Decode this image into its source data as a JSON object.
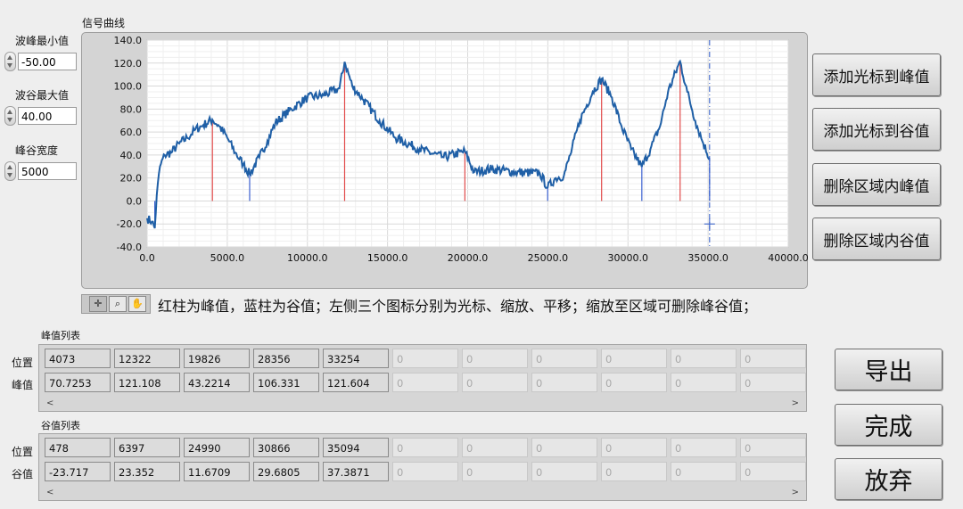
{
  "controls": {
    "peak_min": {
      "label": "波峰最小值",
      "value": "-50.00"
    },
    "valley_max": {
      "label": "波谷最大值",
      "value": "40.00"
    },
    "peak_valley_width": {
      "label": "峰谷宽度",
      "value": "5000"
    }
  },
  "graph": {
    "title": "信号曲线",
    "note": "红柱为峰值，蓝柱为谷值；左侧三个图标分别为光标、缩放、平移；缩放至区域可删除峰谷值；"
  },
  "chart_data": {
    "type": "line",
    "xlim": [
      0,
      40000
    ],
    "ylim": [
      -40,
      140
    ],
    "x_ticks": [
      "0.0",
      "5000.0",
      "10000.0",
      "15000.0",
      "20000.0",
      "25000.0",
      "30000.0",
      "35000.0",
      "40000.0"
    ],
    "y_ticks": [
      "140.0",
      "120.0",
      "100.0",
      "80.0",
      "60.0",
      "40.0",
      "20.0",
      "0.0",
      "-20.0",
      "-40.0"
    ],
    "grid": true,
    "series_color": "#1f5fa6",
    "peak_color": "#e24b4b",
    "valley_color": "#3a5fd0",
    "signal": {
      "x": [
        0,
        300,
        478,
        600,
        800,
        1100,
        1500,
        2000,
        2500,
        3000,
        3500,
        4073,
        4500,
        5000,
        5500,
        6000,
        6397,
        7000,
        7500,
        8000,
        9000,
        10000,
        11000,
        12000,
        12322,
        12800,
        13500,
        14500,
        15500,
        17000,
        18500,
        19826,
        20400,
        21500,
        23000,
        24500,
        24990,
        25500,
        26000,
        26400,
        27000,
        27800,
        28356,
        29000,
        29600,
        30200,
        30866,
        31400,
        32000,
        32500,
        33254,
        33700,
        34200,
        34700,
        35094
      ],
      "y": [
        -15,
        -18,
        -23.7,
        5,
        30,
        40,
        42,
        50,
        55,
        62,
        66,
        70.7,
        65,
        55,
        42,
        32,
        23.4,
        38,
        52,
        68,
        80,
        90,
        92,
        98,
        121.1,
        100,
        88,
        70,
        55,
        45,
        38,
        43.2,
        25,
        28,
        25,
        24,
        11.7,
        20,
        22,
        40,
        70,
        95,
        106.3,
        90,
        65,
        45,
        29.7,
        45,
        65,
        95,
        121.6,
        95,
        70,
        50,
        37.4
      ]
    },
    "peaks": {
      "x": [
        4073,
        12322,
        19826,
        28356,
        33254
      ],
      "y": [
        70.7253,
        121.108,
        43.2214,
        106.331,
        121.604
      ]
    },
    "valleys": {
      "x": [
        478,
        6397,
        24990,
        30866,
        35094
      ],
      "y": [
        -23.717,
        23.352,
        11.6709,
        29.6805,
        37.3871
      ]
    },
    "cursor_x": 35094
  },
  "buttons": {
    "add_peak": "添加光标到峰值",
    "add_valley": "添加光标到谷值",
    "del_peak": "删除区域内峰值",
    "del_valley": "删除区域内谷值",
    "export": "导出",
    "done": "完成",
    "cancel": "放弃"
  },
  "peak_table": {
    "title": "峰值列表",
    "row_labels": [
      "位置",
      "峰值"
    ],
    "rows": [
      [
        "4073",
        "12322",
        "19826",
        "28356",
        "33254",
        "0",
        "0",
        "0",
        "0",
        "0",
        "0"
      ],
      [
        "70.7253",
        "121.108",
        "43.2214",
        "106.331",
        "121.604",
        "0",
        "0",
        "0",
        "0",
        "0",
        "0"
      ]
    ]
  },
  "valley_table": {
    "title": "谷值列表",
    "row_labels": [
      "位置",
      "谷值"
    ],
    "rows": [
      [
        "478",
        "6397",
        "24990",
        "30866",
        "35094",
        "0",
        "0",
        "0",
        "0",
        "0",
        "0"
      ],
      [
        "-23.717",
        "23.352",
        "11.6709",
        "29.6805",
        "37.3871",
        "0",
        "0",
        "0",
        "0",
        "0",
        "0"
      ]
    ]
  },
  "palette": {
    "icons": [
      "cursor-icon",
      "zoom-icon",
      "pan-icon"
    ]
  }
}
